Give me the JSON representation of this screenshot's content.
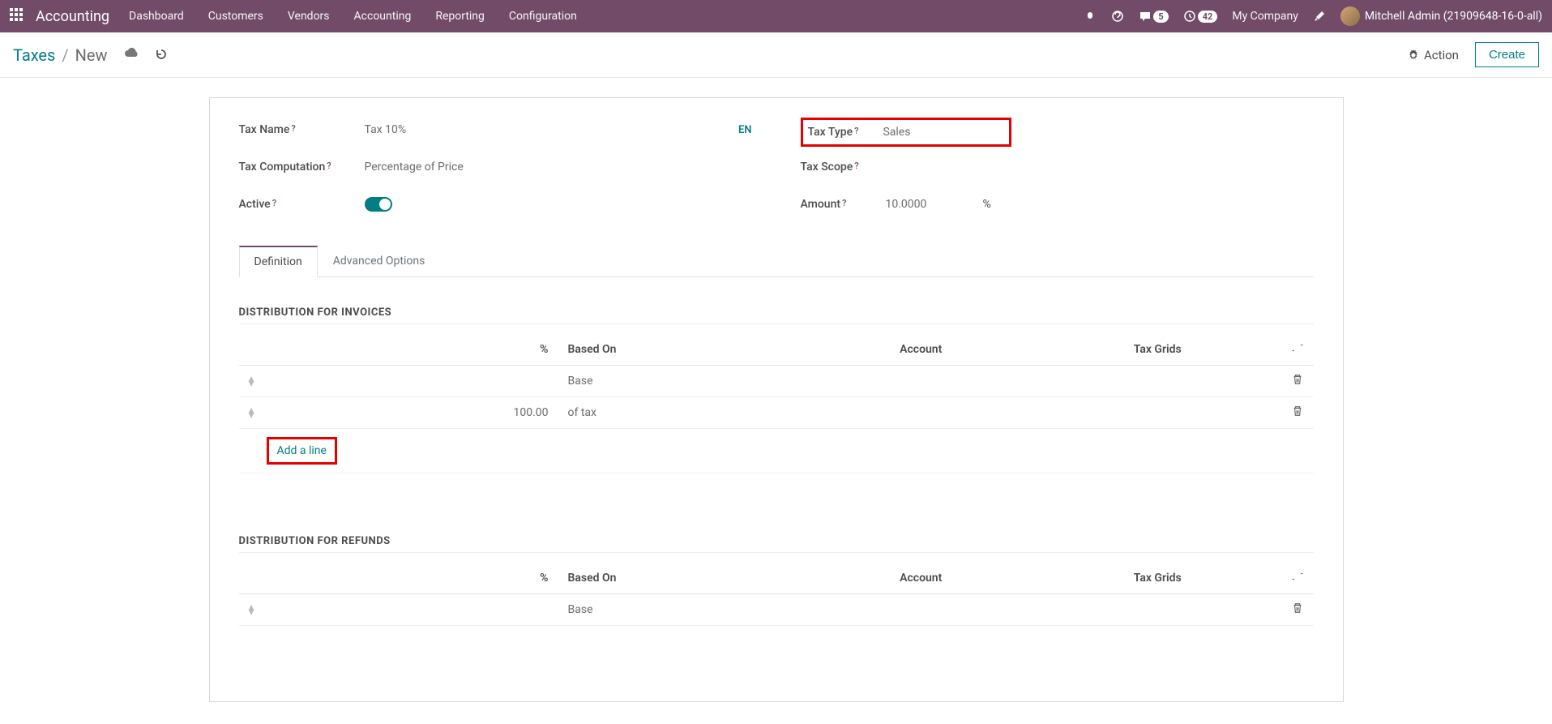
{
  "navbar": {
    "brand": "Accounting",
    "menu": [
      "Dashboard",
      "Customers",
      "Vendors",
      "Accounting",
      "Reporting",
      "Configuration"
    ],
    "messages_count": "5",
    "activities_count": "42",
    "company": "My Company",
    "user": "Mitchell Admin (21909648-16-0-all)"
  },
  "breadcrumb": {
    "root": "Taxes",
    "current": "New",
    "action_label": "Action",
    "create_label": "Create"
  },
  "form": {
    "tax_name_label": "Tax Name",
    "tax_name_value": "Tax 10%",
    "lang": "EN",
    "tax_computation_label": "Tax Computation",
    "tax_computation_value": "Percentage of Price",
    "active_label": "Active",
    "tax_type_label": "Tax Type",
    "tax_type_value": "Sales",
    "tax_scope_label": "Tax Scope",
    "amount_label": "Amount",
    "amount_value": "10.0000",
    "amount_unit": "%"
  },
  "tabs": {
    "definition": "Definition",
    "advanced": "Advanced Options"
  },
  "sections": {
    "invoices_title": "DISTRIBUTION FOR INVOICES",
    "refunds_title": "DISTRIBUTION FOR REFUNDS"
  },
  "table": {
    "col_percent": "%",
    "col_based_on": "Based On",
    "col_account": "Account",
    "col_tax_grids": "Tax Grids",
    "rows_invoices": [
      {
        "percent": "",
        "based_on": "Base"
      },
      {
        "percent": "100.00",
        "based_on": "of tax"
      }
    ],
    "add_line": "Add a line",
    "rows_refunds": [
      {
        "percent": "",
        "based_on": "Base"
      }
    ]
  }
}
